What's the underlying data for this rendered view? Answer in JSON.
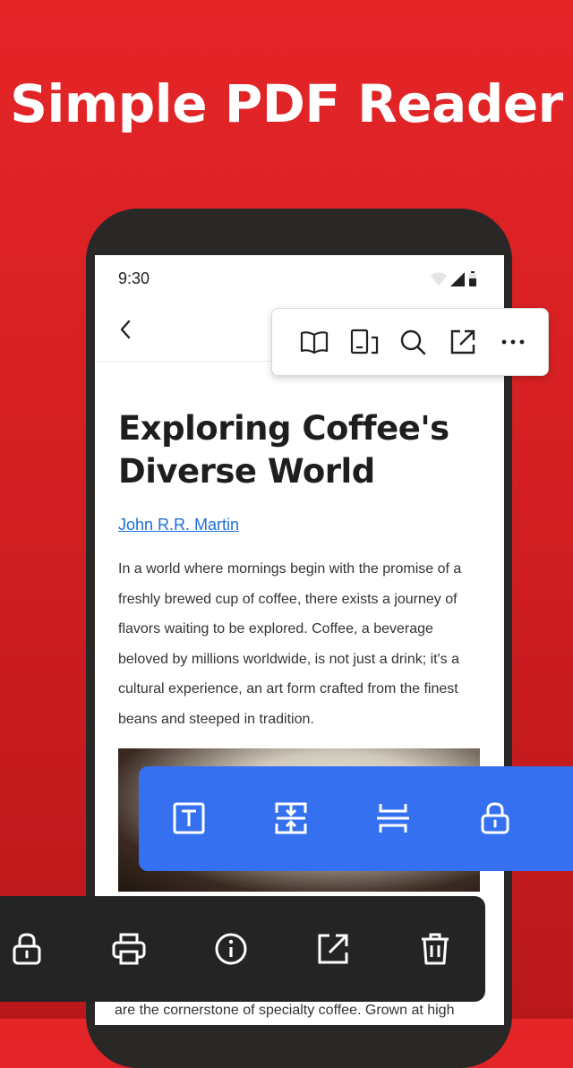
{
  "headline": "Simple PDF Reader",
  "status_bar": {
    "time": "9:30",
    "icons": [
      "wifi-icon",
      "signal-icon",
      "battery-icon"
    ]
  },
  "header": {
    "back_icon": "chevron-left-icon"
  },
  "top_toolbar": {
    "icons": [
      "book-icon",
      "page-layout-icon",
      "search-icon",
      "share-icon",
      "more-icon"
    ]
  },
  "document": {
    "title": "Exploring Coffee's Diverse World",
    "author": "John R.R. Martin",
    "body": "In a world where mornings begin with the promise of a freshly brewed cup of coffee, there exists a journey of flavors waiting to be explored. Coffee, a beverage beloved by millions worldwide, is not just a drink; it's a cultural experience, an art form crafted from the finest beans and steeped in tradition.",
    "body_bottom": "are the cornerstone of specialty coffee. Grown at high"
  },
  "edit_toolbar": {
    "icons": [
      "text-icon",
      "compress-icon",
      "split-icon",
      "lock-icon"
    ]
  },
  "file_toolbar": {
    "icons": [
      "lock-icon",
      "print-icon",
      "info-icon",
      "share-icon",
      "trash-icon"
    ]
  },
  "colors": {
    "background_red": "#d41f22",
    "toolbar_blue": "#3470f0",
    "toolbar_dark": "#242424",
    "link_blue": "#1b6fd8"
  }
}
